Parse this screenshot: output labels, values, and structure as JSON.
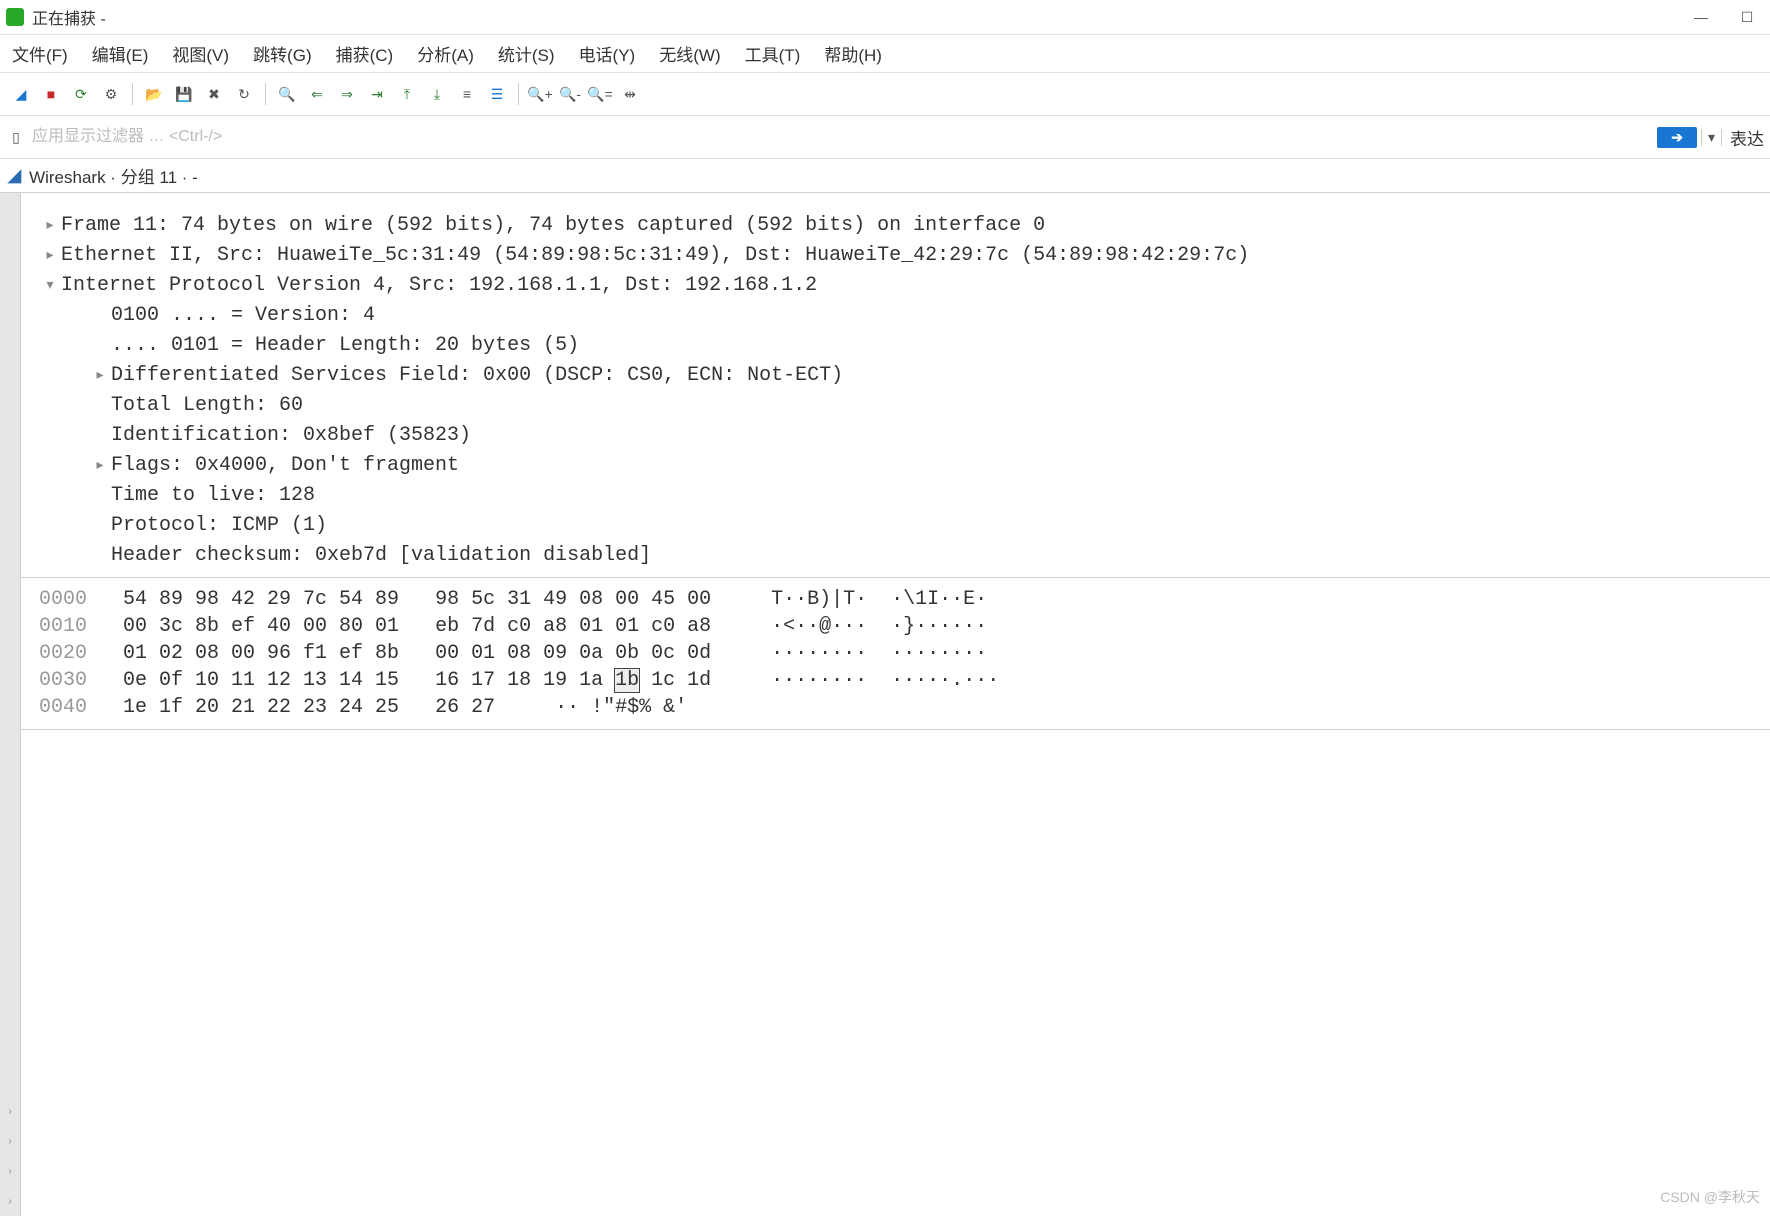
{
  "window": {
    "title": "正在捕获 -",
    "minimize": "—",
    "maximize": "☐"
  },
  "menu": [
    "文件(F)",
    "编辑(E)",
    "视图(V)",
    "跳转(G)",
    "捕获(C)",
    "分析(A)",
    "统计(S)",
    "电话(Y)",
    "无线(W)",
    "工具(T)",
    "帮助(H)"
  ],
  "toolbar_icons": [
    {
      "name": "shark-fin-icon",
      "glyph": "◢",
      "cls": "blue"
    },
    {
      "name": "stop-capture-icon",
      "glyph": "■",
      "cls": "red"
    },
    {
      "name": "restart-capture-icon",
      "glyph": "⟳",
      "cls": "green"
    },
    {
      "name": "options-icon",
      "glyph": "⚙",
      "cls": ""
    },
    {
      "name": "sep"
    },
    {
      "name": "open-file-icon",
      "glyph": "📂",
      "cls": ""
    },
    {
      "name": "save-icon",
      "glyph": "💾",
      "cls": ""
    },
    {
      "name": "close-icon",
      "glyph": "✖",
      "cls": ""
    },
    {
      "name": "reload-icon",
      "glyph": "↻",
      "cls": ""
    },
    {
      "name": "sep"
    },
    {
      "name": "find-icon",
      "glyph": "🔍",
      "cls": ""
    },
    {
      "name": "go-back-icon",
      "glyph": "⇐",
      "cls": "green"
    },
    {
      "name": "go-forward-icon",
      "glyph": "⇒",
      "cls": "green"
    },
    {
      "name": "jump-icon",
      "glyph": "⇥",
      "cls": "green"
    },
    {
      "name": "go-first-icon",
      "glyph": "⤒",
      "cls": "green"
    },
    {
      "name": "go-last-icon",
      "glyph": "⤓",
      "cls": "green"
    },
    {
      "name": "auto-scroll-icon",
      "glyph": "≡",
      "cls": ""
    },
    {
      "name": "colorize-icon",
      "glyph": "☰",
      "cls": "blue"
    },
    {
      "name": "sep"
    },
    {
      "name": "zoom-in-icon",
      "glyph": "🔍+",
      "cls": ""
    },
    {
      "name": "zoom-out-icon",
      "glyph": "🔍-",
      "cls": ""
    },
    {
      "name": "zoom-reset-icon",
      "glyph": "🔍=",
      "cls": ""
    },
    {
      "name": "resize-columns-icon",
      "glyph": "⇹",
      "cls": ""
    }
  ],
  "filter": {
    "placeholder": "应用显示过滤器 … <Ctrl-/>",
    "apply": "➔",
    "right_label": "表达"
  },
  "subtitle": "Wireshark · 分组 11 · -",
  "details": {
    "lines": [
      {
        "toggle": ">",
        "indent": 0,
        "text": "Frame 11: 74 bytes on wire (592 bits), 74 bytes captured (592 bits) on interface 0"
      },
      {
        "toggle": ">",
        "indent": 0,
        "text": "Ethernet II, Src: HuaweiTe_5c:31:49 (54:89:98:5c:31:49), Dst: HuaweiTe_42:29:7c (54:89:98:42:29:7c)"
      },
      {
        "toggle": "v",
        "indent": 0,
        "text": "Internet Protocol Version 4, Src: 192.168.1.1, Dst: 192.168.1.2"
      },
      {
        "toggle": "",
        "indent": 2,
        "text": "0100 .... = Version: 4"
      },
      {
        "toggle": "",
        "indent": 2,
        "text": ".... 0101 = Header Length: 20 bytes (5)"
      },
      {
        "toggle": ">",
        "indent": 2,
        "text": "Differentiated Services Field: 0x00 (DSCP: CS0, ECN: Not-ECT)"
      },
      {
        "toggle": "",
        "indent": 2,
        "text": "Total Length: 60"
      },
      {
        "toggle": "",
        "indent": 2,
        "text": "Identification: 0x8bef (35823)"
      },
      {
        "toggle": ">",
        "indent": 2,
        "text": "Flags: 0x4000, Don't fragment"
      },
      {
        "toggle": "",
        "indent": 2,
        "text": "Time to live: 128"
      },
      {
        "toggle": "",
        "indent": 2,
        "text": "Protocol: ICMP (1)"
      },
      {
        "toggle": "",
        "indent": 2,
        "text": "Header checksum: 0xeb7d [validation disabled]"
      }
    ]
  },
  "hexdump": [
    {
      "offset": "0000",
      "bytes": "54 89 98 42 29 7c 54 89   98 5c 31 49 08 00 45 00",
      "ascii": "T··B)|T·  ·\\1I··E·"
    },
    {
      "offset": "0010",
      "bytes": "00 3c 8b ef 40 00 80 01   eb 7d c0 a8 01 01 c0 a8",
      "ascii": "·<··@···  ·}······"
    },
    {
      "offset": "0020",
      "bytes": "01 02 08 00 96 f1 ef 8b   00 01 08 09 0a 0b 0c 0d",
      "ascii": "········  ········"
    },
    {
      "offset": "0030",
      "bytes": "0e 0f 10 11 12 13 14 15   16 17 18 19 1a 1b 1c 1d",
      "ascii": "········  ·····.···",
      "sel_byte": "1b"
    },
    {
      "offset": "0040",
      "bytes": "1e 1f 20 21 22 23 24 25   26 27",
      "ascii": "·· !\"#$% &'"
    }
  ],
  "footer": "CSDN @李秋天"
}
